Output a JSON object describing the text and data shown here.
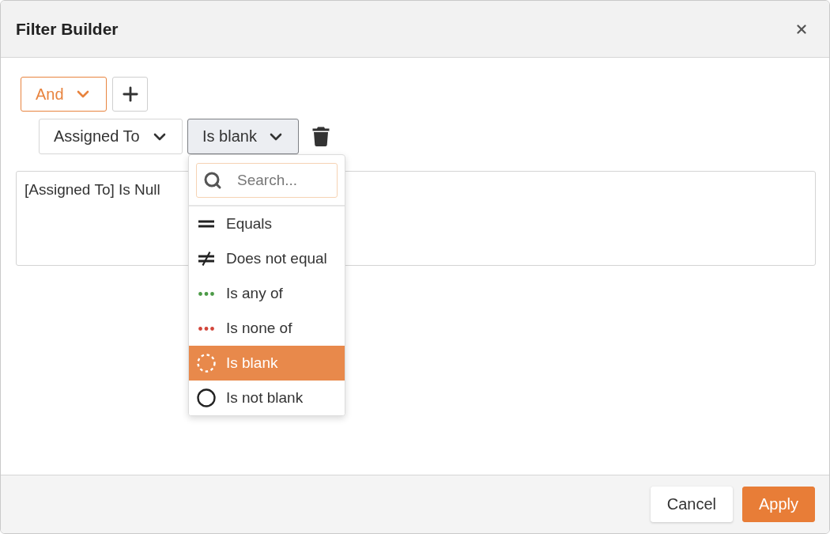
{
  "dialog": {
    "title": "Filter Builder"
  },
  "group": {
    "operator": "And"
  },
  "condition": {
    "field": "Assigned To",
    "operation": "Is blank",
    "dropdown_open": true
  },
  "operation_menu": {
    "search": {
      "placeholder": "Search..."
    },
    "items": [
      {
        "label": "Equals",
        "kind": "equals",
        "selected": false
      },
      {
        "label": "Does not equal",
        "kind": "not_equals",
        "selected": false
      },
      {
        "label": "Is any of",
        "kind": "any_of",
        "selected": false
      },
      {
        "label": "Is none of",
        "kind": "none_of",
        "selected": false
      },
      {
        "label": "Is blank",
        "kind": "blank",
        "selected": true
      },
      {
        "label": "Is not blank",
        "kind": "not_blank",
        "selected": false
      }
    ]
  },
  "expression": "[Assigned To] Is Null",
  "buttons": [
    {
      "label": "Cancel",
      "kind": "secondary"
    },
    {
      "label": "Apply",
      "kind": "primary"
    }
  ]
}
